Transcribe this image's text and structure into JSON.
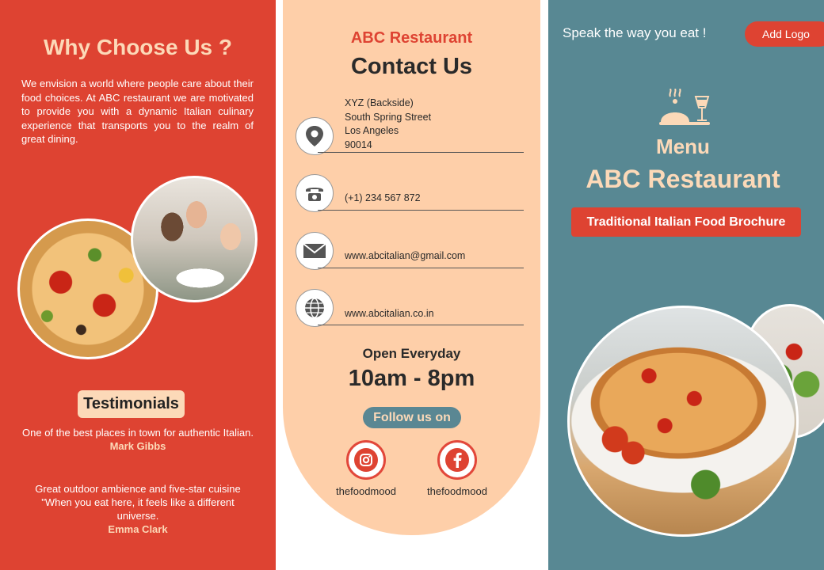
{
  "left": {
    "why_title": "Why Choose Us ?",
    "why_text": "We envision a  world where people care about their food choices. At ABC restaurant we are motivated to provide you with a dynamic Italian culinary experience that transports you to the realm of great dining.",
    "testimonials_label": "Testimonials",
    "testimonials": [
      {
        "quote": "One of the best places in town for authentic Italian.",
        "author": "Mark Gibbs"
      },
      {
        "quote": "Great outdoor ambience and five-star cuisine \"When you eat here, it feels like a different universe.",
        "author": "Emma Clark"
      }
    ]
  },
  "middle": {
    "brand": "ABC Restaurant",
    "title": "Contact Us",
    "address_lines": [
      "XYZ (Backside)",
      "South Spring Street",
      "Los Angeles",
      "90014"
    ],
    "phone": "(+1) 234 567 872",
    "email": "www.abcitalian@gmail.com",
    "website": "www.abcitalian.co.in",
    "open_label": "Open Everyday",
    "open_hours": "10am - 8pm",
    "follow_label": "Follow us on",
    "social": [
      {
        "icon": "instagram-icon",
        "handle": "thefoodmood"
      },
      {
        "icon": "facebook-icon",
        "handle": "thefoodmood"
      }
    ]
  },
  "right": {
    "slogan": "Speak the way you eat !",
    "add_logo": "Add Logo",
    "menu_label": "Menu",
    "brand": "ABC Restaurant",
    "tagline": "Traditional Italian Food Brochure"
  },
  "colors": {
    "red": "#de4332",
    "peach": "#fecfa9",
    "teal": "#588893",
    "light_peach": "#fcd9b8"
  }
}
